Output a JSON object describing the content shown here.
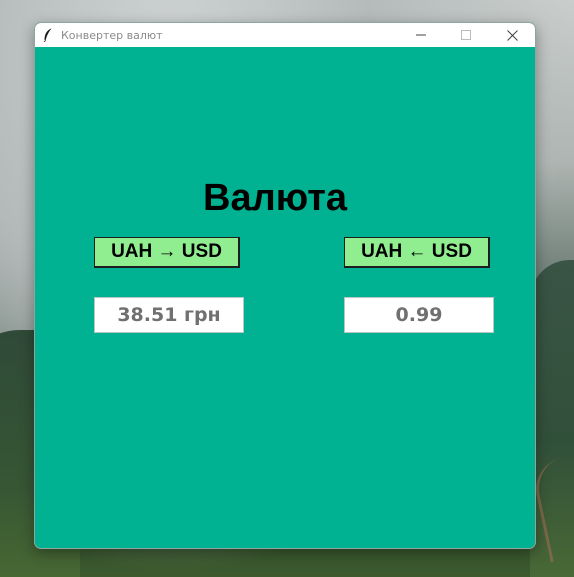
{
  "window": {
    "title": "Конвертер валют",
    "background_color": "#00b291",
    "icon": "feather-icon",
    "controls": {
      "minimize_icon": "minimize-icon",
      "maximize_icon": "maximize-icon",
      "close_icon": "close-icon"
    }
  },
  "main": {
    "heading": "Валюта",
    "buttons": [
      {
        "label": "UAH → USD",
        "color": "#90ee90"
      },
      {
        "label": "UAH ← USD",
        "color": "#90ee90"
      }
    ],
    "results": [
      {
        "value": "38.51 грн"
      },
      {
        "value": "0.99"
      }
    ]
  }
}
